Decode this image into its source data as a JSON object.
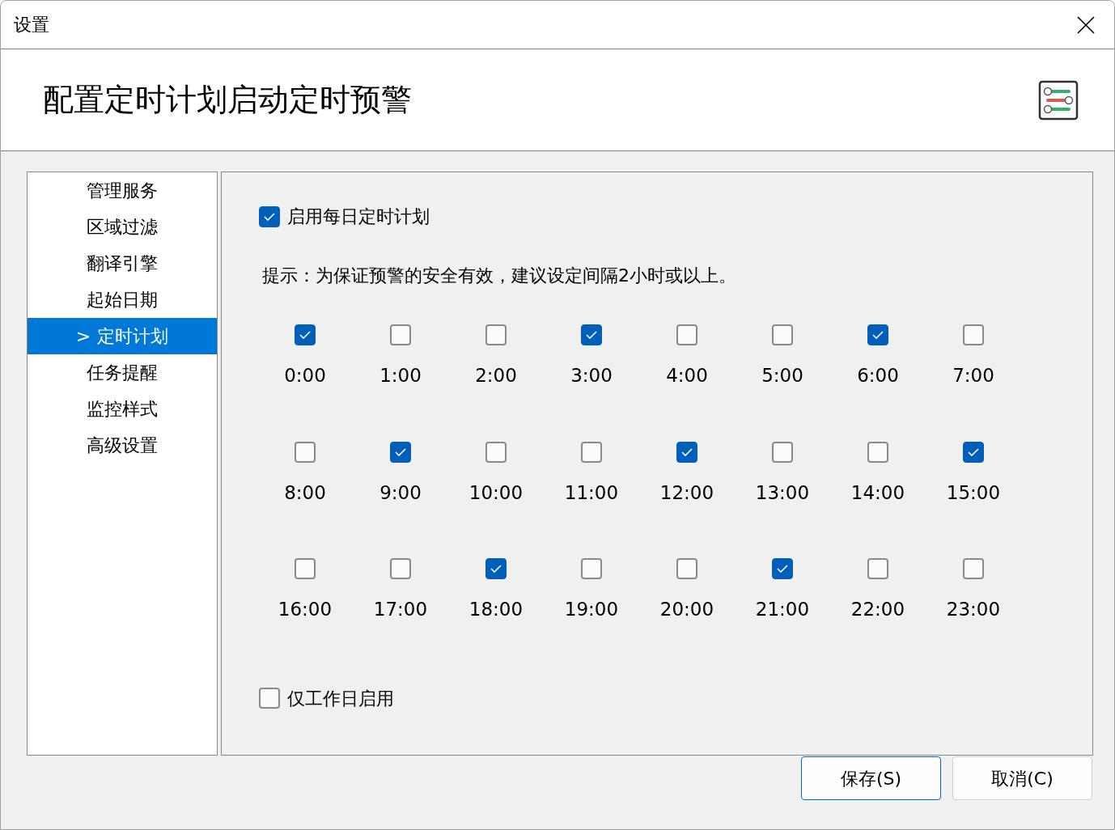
{
  "window": {
    "title": "设置"
  },
  "header": {
    "title": "配置定时计划启动定时预警"
  },
  "sidebar": {
    "selected_marker": ">",
    "items": [
      {
        "label": "管理服务",
        "selected": false
      },
      {
        "label": "区域过滤",
        "selected": false
      },
      {
        "label": "翻译引擎",
        "selected": false
      },
      {
        "label": "起始日期",
        "selected": false
      },
      {
        "label": "定时计划",
        "selected": true
      },
      {
        "label": "任务提醒",
        "selected": false
      },
      {
        "label": "监控样式",
        "selected": false
      },
      {
        "label": "高级设置",
        "selected": false
      }
    ]
  },
  "enable_daily": {
    "label": "启用每日定时计划",
    "checked": true
  },
  "hint": "提示：为保证预警的安全有效，建议设定间隔2小时或以上。",
  "slots": [
    {
      "label": "0:00",
      "checked": true
    },
    {
      "label": "1:00",
      "checked": false
    },
    {
      "label": "2:00",
      "checked": false
    },
    {
      "label": "3:00",
      "checked": true
    },
    {
      "label": "4:00",
      "checked": false
    },
    {
      "label": "5:00",
      "checked": false
    },
    {
      "label": "6:00",
      "checked": true
    },
    {
      "label": "7:00",
      "checked": false
    },
    {
      "label": "8:00",
      "checked": false
    },
    {
      "label": "9:00",
      "checked": true
    },
    {
      "label": "10:00",
      "checked": false
    },
    {
      "label": "11:00",
      "checked": false
    },
    {
      "label": "12:00",
      "checked": true
    },
    {
      "label": "13:00",
      "checked": false
    },
    {
      "label": "14:00",
      "checked": false
    },
    {
      "label": "15:00",
      "checked": true
    },
    {
      "label": "16:00",
      "checked": false
    },
    {
      "label": "17:00",
      "checked": false
    },
    {
      "label": "18:00",
      "checked": true
    },
    {
      "label": "19:00",
      "checked": false
    },
    {
      "label": "20:00",
      "checked": false
    },
    {
      "label": "21:00",
      "checked": true
    },
    {
      "label": "22:00",
      "checked": false
    },
    {
      "label": "23:00",
      "checked": false
    }
  ],
  "workdays_only": {
    "label": "仅工作日启用",
    "checked": false
  },
  "buttons": [
    {
      "label": "保存(S)",
      "kind": "primary"
    },
    {
      "label": "取消(C)",
      "kind": "secondary"
    }
  ]
}
